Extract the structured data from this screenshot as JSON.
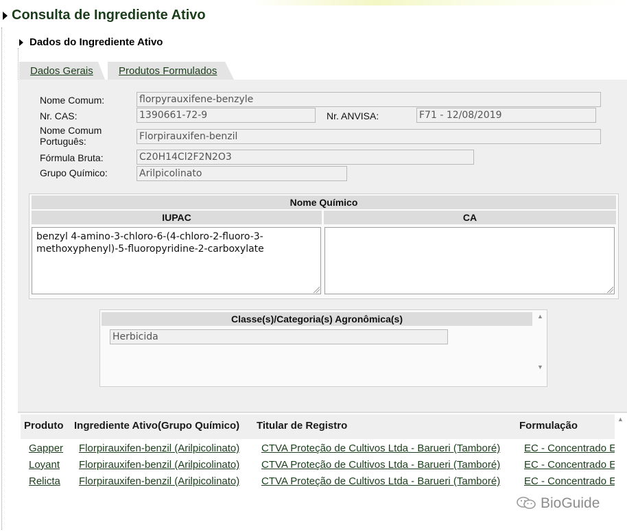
{
  "page": {
    "title": "Consulta de Ingrediente Ativo",
    "section_title": "Dados do Ingrediente Ativo"
  },
  "tabs": [
    {
      "label": "Dados Gerais"
    },
    {
      "label": "Produtos Formulados"
    }
  ],
  "general": {
    "nome_comum_label": "Nome Comum:",
    "nome_comum_value": "florpyrauxifene-benzyle",
    "cas_label": "Nr. CAS:",
    "cas_value": "1390661-72-9",
    "anvisa_label": "Nr. ANVISA:",
    "anvisa_value": "F71 - 12/08/2019",
    "nome_pt_label_line1": "Nome Comum",
    "nome_pt_label_line2": "Português:",
    "nome_pt_value": "Florpirauxifen-benzil",
    "formula_label": "Fórmula Bruta:",
    "formula_value": "C20H14Cl2F2N2O3",
    "grupo_label": "Grupo Químico:",
    "grupo_value": "Arilpicolinato"
  },
  "chemical_name": {
    "header": "Nome Químico",
    "iupac_header": "IUPAC",
    "ca_header": "CA",
    "iupac_value": "benzyl 4-amino-3-chloro-6-(4-chloro-2-fluoro-3-methoxyphenyl)-5-fluoropyridine-2-carboxylate",
    "ca_value": ""
  },
  "classes": {
    "header": "Classe(s)/Categoria(s) Agronômica(s)",
    "items": [
      "Herbicida"
    ]
  },
  "products": {
    "columns": [
      "Produto",
      "Ingrediente Ativo(Grupo Químico)",
      "Titular de Registro",
      "Formulação"
    ],
    "rows": [
      {
        "produto": "Gapper",
        "ingrediente": "Florpirauxifen-benzil (Arilpicolinato)",
        "titular": "CTVA Proteção de Cultivos Ltda - Barueri (Tamboré)",
        "formulacao": "EC - Concentrado Emulsionável"
      },
      {
        "produto": "Loyant",
        "ingrediente": "Florpirauxifen-benzil (Arilpicolinato)",
        "titular": "CTVA Proteção de Cultivos Ltda - Barueri (Tamboré)",
        "formulacao": "EC - Concentrado Emulsionável"
      },
      {
        "produto": "Relicta",
        "ingrediente": "Florpirauxifen-benzil (Arilpicolinato)",
        "titular": "CTVA Proteção de Cultivos Ltda - Barueri (Tamboré)",
        "formulacao": "EC - Concentrado Emulsionável"
      }
    ]
  },
  "watermark": {
    "text": "BioGuide",
    "icon": "wechat-icon"
  }
}
